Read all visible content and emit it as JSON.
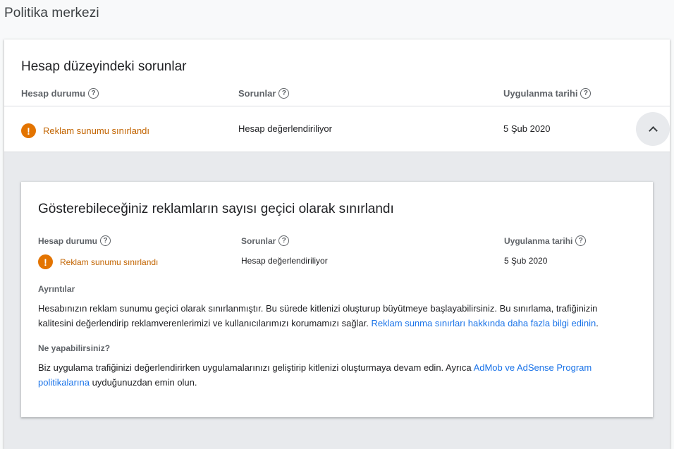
{
  "page": {
    "title": "Politika merkezi"
  },
  "account_issues": {
    "title": "Hesap düzeyindeki sorunlar",
    "headers": {
      "status": "Hesap durumu",
      "issues": "Sorunlar",
      "date": "Uygulanma tarihi"
    },
    "row": {
      "status": "Reklam sunumu sınırlandı",
      "issue": "Hesap değerlendiriliyor",
      "date": "5 Şub 2020"
    }
  },
  "detail": {
    "title": "Gösterebileceğiniz reklamların sayısı geçici olarak sınırlandı",
    "headers": {
      "status": "Hesap durumu",
      "issues": "Sorunlar",
      "date": "Uygulanma tarihi"
    },
    "row": {
      "status": "Reklam sunumu sınırlandı",
      "issue": "Hesap değerlendiriliyor",
      "date": "5 Şub 2020"
    },
    "details_label": "Ayrıntılar",
    "details_text": "Hesabınızın reklam sunumu geçici olarak sınırlanmıştır. Bu sürede kitlenizi oluşturup büyütmeye başlayabilirsiniz. Bu sınırlama, trafiğinizin kalitesini değerlendirip reklamverenlerimizi ve kullanıcılarımızı korumamızı sağlar. ",
    "details_link": "Reklam sunma sınırları hakkında daha fazla bilgi edinin",
    "details_end": ".",
    "todo_label": "Ne yapabilirsiniz?",
    "todo_text": "Biz uygulama trafiğinizi değerlendirirken uygulamalarınızı geliştirip kitlenizi oluşturmaya devam edin. Ayrıca ",
    "todo_link": "AdMob ve AdSense Program politikalarına",
    "todo_end": " uyduğunuzdan emin olun."
  },
  "icons": {
    "help": "?",
    "warning": "!"
  },
  "colors": {
    "warning": "#e37400",
    "link": "#1a73e8"
  }
}
